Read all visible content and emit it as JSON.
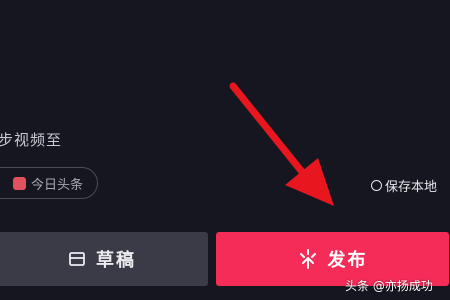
{
  "publish_panel": {
    "sync_label": "步视频至",
    "toutiao_chip": {
      "label": "今日头条",
      "icon": "toutiao-logo-icon"
    },
    "save_local": {
      "label": "保存本地",
      "icon": "radio-unchecked-icon"
    },
    "draft_button": {
      "label": "草稿",
      "icon": "draft-box-icon"
    },
    "publish_button": {
      "label": "发布",
      "icon": "publish-sparkle-icon"
    }
  },
  "colors": {
    "background": "#151620",
    "publish_button": "#f52b58",
    "draft_button": "#3a3b46",
    "annotation_arrow": "#e8171f"
  },
  "watermark": "头条 @亦扬成功"
}
